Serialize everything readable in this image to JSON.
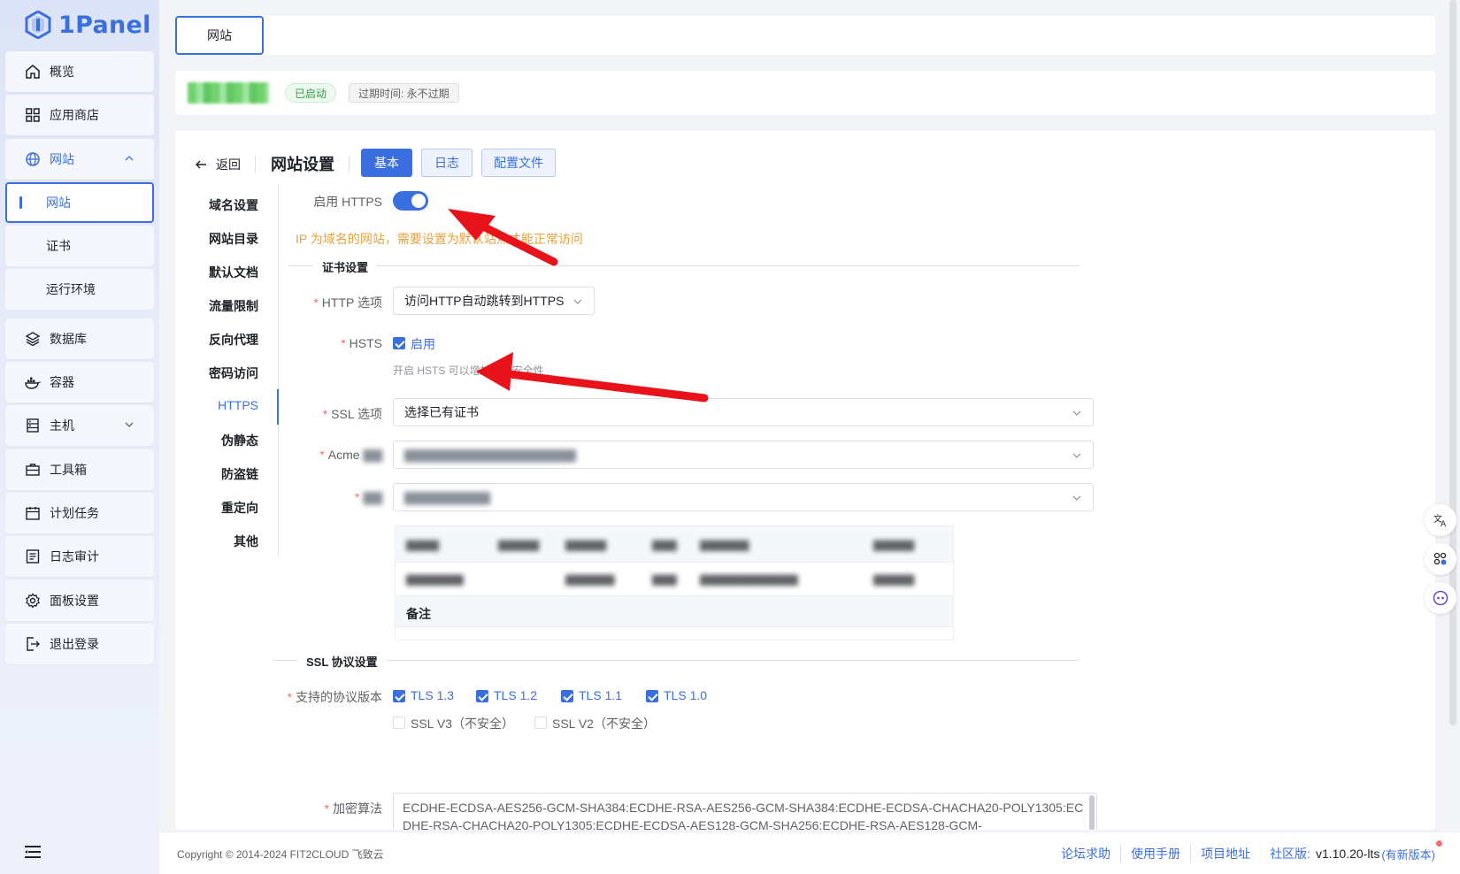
{
  "app": {
    "logo_text": "1Panel"
  },
  "sidebar": {
    "items": [
      {
        "label": "概览",
        "icon": "home-icon"
      },
      {
        "label": "应用商店",
        "icon": "grid-icon"
      },
      {
        "label": "网站",
        "icon": "globe-icon",
        "expanded": true
      },
      {
        "label": "网站",
        "sub": true,
        "selected": true
      },
      {
        "label": "证书",
        "sub": true
      },
      {
        "label": "运行环境",
        "sub": true
      },
      {
        "label": "数据库",
        "icon": "layers-icon"
      },
      {
        "label": "容器",
        "icon": "docker-icon"
      },
      {
        "label": "主机",
        "icon": "server-icon"
      },
      {
        "label": "工具箱",
        "icon": "toolbox-icon"
      },
      {
        "label": "计划任务",
        "icon": "calendar-icon"
      },
      {
        "label": "日志审计",
        "icon": "log-icon"
      },
      {
        "label": "面板设置",
        "icon": "gear-icon"
      },
      {
        "label": "退出登录",
        "icon": "logout-icon"
      }
    ]
  },
  "topbar": {
    "tab_label": "网站"
  },
  "info": {
    "status": "已启动",
    "expire": "过期时间: 永不过期"
  },
  "header": {
    "back_label": "返回",
    "title": "网站设置",
    "btn_basic": "基本",
    "btn_log": "日志",
    "btn_config": "配置文件"
  },
  "subnav": {
    "items": [
      "域名设置",
      "网站目录",
      "默认文档",
      "流量限制",
      "反向代理",
      "密码访问",
      "HTTPS",
      "伪静态",
      "防盗链",
      "重定向",
      "其他"
    ],
    "active": "HTTPS"
  },
  "form": {
    "enable_https_label": "启用 HTTPS",
    "enable_https_on": true,
    "ip_warning": "IP 为域名的网站，需要设置为默认站点才能正常访问",
    "cert_section": "证书设置",
    "http_option_label": "HTTP 选项",
    "http_option_value": "访问HTTP自动跳转到HTTPS",
    "hsts_label": "HSTS",
    "hsts_checkbox": "启用",
    "hsts_hint": "开启 HSTS 可以增加网站安全性",
    "ssl_option_label": "SSL 选项",
    "ssl_option_value": "选择已有证书",
    "acme_label": "Acme",
    "cert_note_label": "备注",
    "ssl_section": "SSL 协议设置",
    "protocols_label": "支持的协议版本",
    "protocols": [
      {
        "label": "TLS 1.3",
        "checked": true
      },
      {
        "label": "TLS 1.2",
        "checked": true
      },
      {
        "label": "TLS 1.1",
        "checked": true
      },
      {
        "label": "TLS 1.0",
        "checked": true
      },
      {
        "label": "SSL V3（不安全）",
        "checked": false
      },
      {
        "label": "SSL V2（不安全）",
        "checked": false
      }
    ],
    "cipher_label": "加密算法",
    "cipher_value": "ECDHE-ECDSA-AES256-GCM-SHA384:ECDHE-RSA-AES256-GCM-SHA384:ECDHE-ECDSA-CHACHA20-POLY1305:ECDHE-RSA-CHACHA20-POLY1305:ECDHE-ECDSA-AES128-GCM-SHA256:ECDHE-RSA-AES128-GCM-"
  },
  "footer": {
    "copyright": "Copyright © 2014-2024 FIT2CLOUD 飞致云",
    "links": [
      "论坛求助",
      "使用手册",
      "项目地址"
    ],
    "edition": "社区版:",
    "version": "v1.10.20-lts",
    "update": "(有新版本)"
  },
  "colors": {
    "accent": "#3b6fe0",
    "warning": "#e6a23c",
    "success": "#2ea043",
    "annotation_arrow": "#e8121a"
  }
}
